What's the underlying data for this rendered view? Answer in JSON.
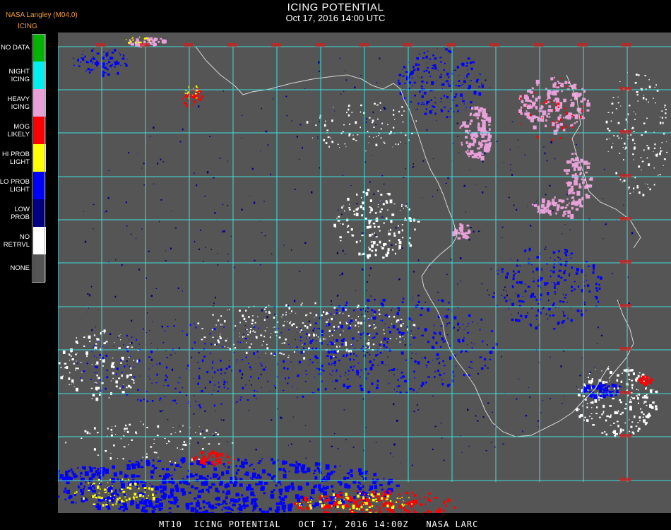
{
  "header": {
    "title": "ICING POTENTIAL",
    "subtitle": "Oct 17, 2016 14:00 UTC",
    "credit": "NASA Langley (M04.0)"
  },
  "legend": {
    "heading": "ICING",
    "items": [
      {
        "label_lines": [
          "NO DATA"
        ],
        "color": "#00b400"
      },
      {
        "label_lines": [
          "NIGHT",
          "ICING"
        ],
        "color": "#00f0f0"
      },
      {
        "label_lines": [
          "HEAVY",
          "ICING"
        ],
        "color": "#e8a0d8"
      },
      {
        "label_lines": [
          "MOG",
          "LIKELY"
        ],
        "color": "#ff0000"
      },
      {
        "label_lines": [
          "HI PROB",
          "LIGHT"
        ],
        "color": "#ffff00"
      },
      {
        "label_lines": [
          "LO PROB",
          "LIGHT"
        ],
        "color": "#0000ff"
      },
      {
        "label_lines": [
          "LOW",
          "PROB"
        ],
        "color": "#000080"
      },
      {
        "label_lines": [
          "NO",
          "RETRVL"
        ],
        "color": "#ffffff"
      },
      {
        "label_lines": [
          "NONE"
        ],
        "color": "#555555"
      }
    ]
  },
  "map": {
    "background_color": "#555555",
    "grid_color": "#40e0e0",
    "coastline_color": "#d8d8d8",
    "grid_label_color": "#cc2020"
  },
  "footer": {
    "text": "MT10  ICING POTENTIAL   OCT 17, 2016 14:00Z   NASA LARC"
  }
}
